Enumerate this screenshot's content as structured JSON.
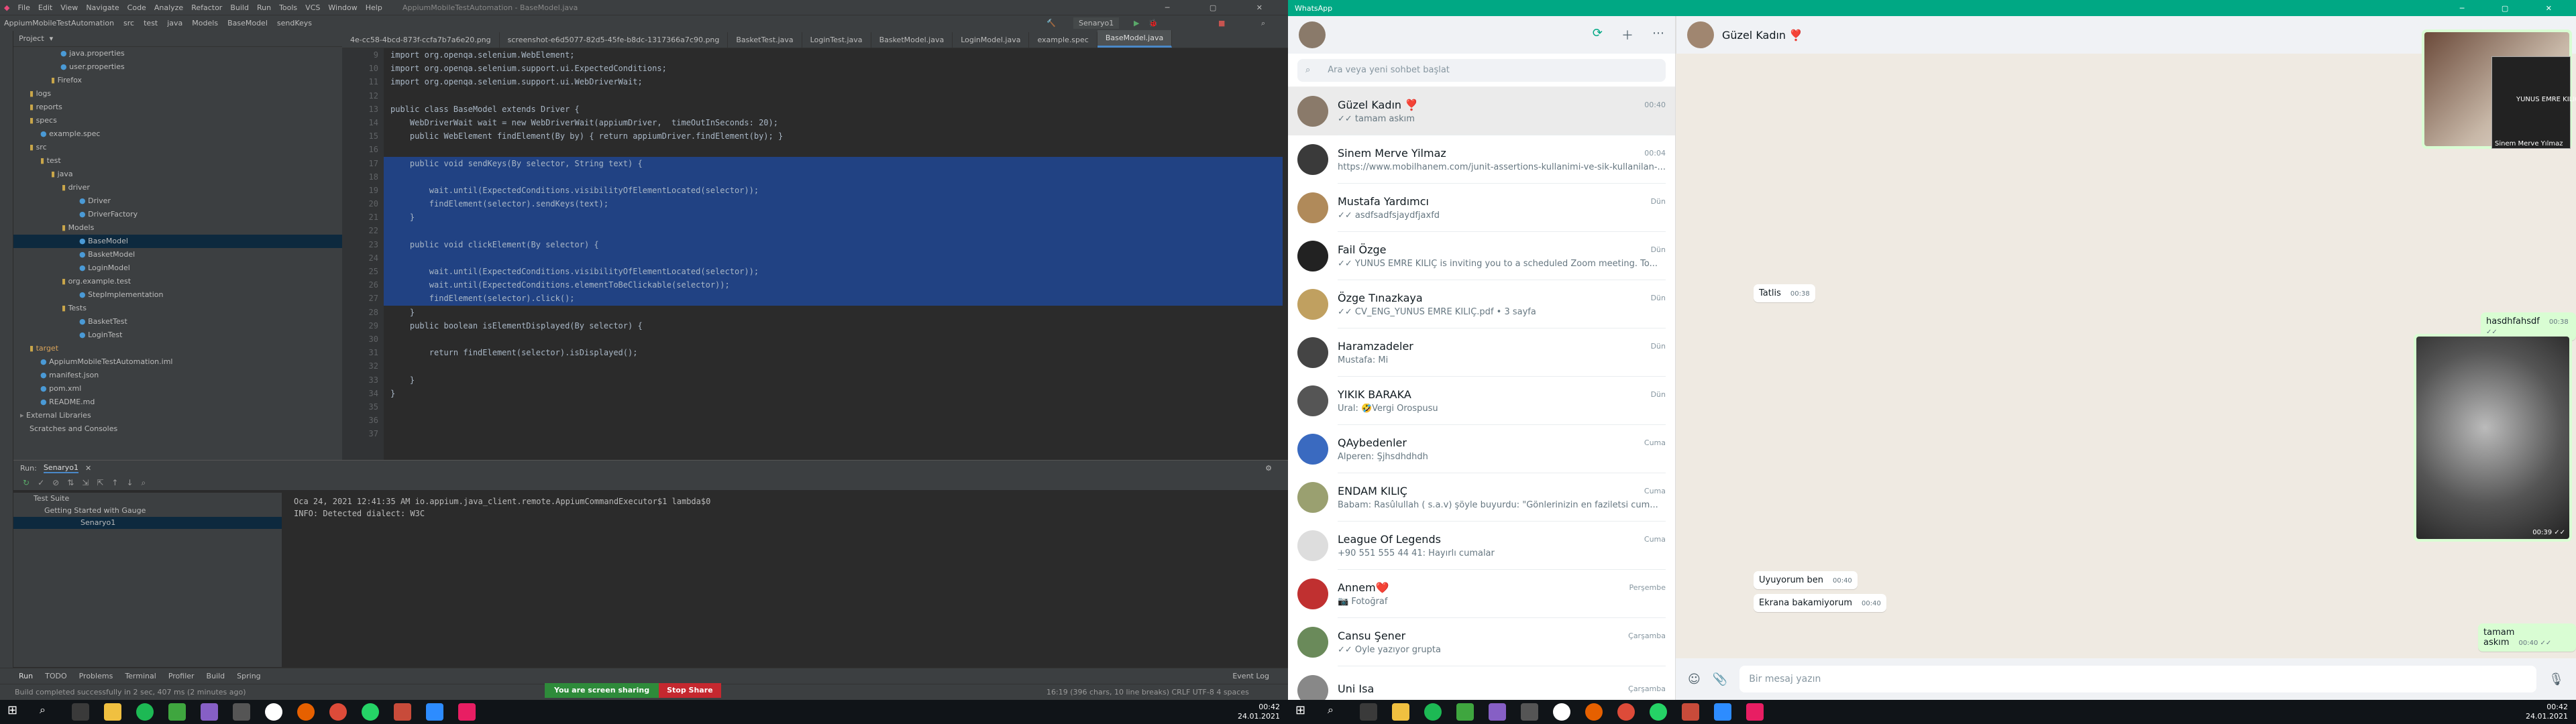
{
  "ide": {
    "title": "AppiumMobileTestAutomation - BaseModel.java",
    "menu": [
      "File",
      "Edit",
      "View",
      "Navigate",
      "Code",
      "Analyze",
      "Refactor",
      "Build",
      "Run",
      "Tools",
      "VCS",
      "Window",
      "Help"
    ],
    "breadcrumbs": [
      "AppiumMobileTestAutomation",
      "src",
      "test",
      "java",
      "Models",
      "BaseModel",
      "sendKeys"
    ],
    "run_config": "Senaryo1",
    "project_label": "Project",
    "tree": [
      "java.properties",
      "user.properties",
      "Firefox",
      "logs",
      "reports",
      "specs",
      "example.spec",
      "src",
      "test",
      "java",
      "driver",
      "Driver",
      "DriverFactory",
      "Models",
      "BaseModel",
      "BasketModel",
      "LoginModel",
      "org.example.test",
      "StepImplementation",
      "Tests",
      "BasketTest",
      "LoginTest",
      "target",
      "AppiumMobileTestAutomation.iml",
      "manifest.json",
      "pom.xml",
      "README.md",
      "External Libraries",
      "Scratches and Consoles"
    ],
    "tabs": [
      "4e-cc58-4bcd-873f-ccfa7b7a6e20.png",
      "screenshot-e6d5077-82d5-45fe-b8dc-1317366a7c90.png",
      "BasketTest.java",
      "LoginTest.java",
      "BasketModel.java",
      "LoginModel.java",
      "example.spec",
      "BaseModel.java"
    ],
    "code": [
      "import org.openqa.selenium.WebElement;",
      "import org.openqa.selenium.support.ui.ExpectedConditions;",
      "import org.openqa.selenium.support.ui.WebDriverWait;",
      "",
      "public class BaseModel extends Driver {",
      "    WebDriverWait wait = new WebDriverWait(appiumDriver,  timeOutInSeconds: 20);",
      "    public WebElement findElement(By by) { return appiumDriver.findElement(by); }",
      "",
      "    public void sendKeys(By selector, String text) {",
      "",
      "        wait.until(ExpectedConditions.visibilityOfElementLocated(selector));",
      "        findElement(selector).sendKeys(text);",
      "    }",
      "",
      "    public void clickElement(By selector) {",
      "",
      "        wait.until(ExpectedConditions.visibilityOfElementLocated(selector));",
      "        wait.until(ExpectedConditions.elementToBeClickable(selector));",
      "        findElement(selector).click();",
      "    }",
      "    public boolean isElementDisplayed(By selector) {",
      "",
      "        return findElement(selector).isDisplayed();",
      "",
      "    }",
      "}",
      "",
      "",
      ""
    ],
    "line_numbers": [
      "9",
      "10",
      "11",
      "12",
      "13",
      "14",
      "15",
      "16",
      "17",
      "18",
      "19",
      "20",
      "21",
      "22",
      "23",
      "24",
      "25",
      "26",
      "27",
      "28",
      "29",
      "30",
      "31",
      "32",
      "33",
      "34",
      "35",
      "36",
      "37"
    ],
    "run_label": "Run:",
    "run_tab": "Senaryo1",
    "run_tree": [
      "Test Suite",
      "Getting Started with Gauge",
      "Senaryo1"
    ],
    "console": [
      "Oca 24, 2021 12:41:35 AM io.appium.java_client.remote.AppiumCommandExecutor$1 lambda$0",
      "INFO: Detected dialect: W3C"
    ],
    "bottom_tools": [
      "Run",
      "TODO",
      "Problems",
      "Terminal",
      "Profiler",
      "Build",
      "Spring"
    ],
    "event_log": "Event Log",
    "status": "Build completed successfully in 2 sec, 407 ms (2 minutes ago)",
    "status_right": "16:19 (396 chars, 10 line breaks)   CRLF   UTF-8   4 spaces",
    "share_text": "You are screen sharing",
    "stop_share": "Stop Share"
  },
  "whatsapp": {
    "window_title": "WhatsApp",
    "search_placeholder": "Ara veya yeni sohbet başlat",
    "chats": [
      {
        "name": "Güzel Kadın ❣️",
        "time": "00:40",
        "preview": "✓✓ tamam askım"
      },
      {
        "name": "Sinem Merve Yilmaz",
        "time": "00:04",
        "preview": "https://www.mobilhanem.com/junit-assertions-kullanimi-ve-sik-kullanilan-..."
      },
      {
        "name": "Mustafa Yardımcı",
        "time": "Dün",
        "preview": "✓✓ asdfsadfsjaydfjaxfd"
      },
      {
        "name": "Fail Özge",
        "time": "Dün",
        "preview": "✓✓ YUNUS EMRE KILIÇ is inviting you to a scheduled Zoom meeting. To..."
      },
      {
        "name": "Özge Tınazkaya",
        "time": "Dün",
        "preview": "✓✓ CV_ENG_YUNUS EMRE KILIÇ.pdf • 3 sayfa"
      },
      {
        "name": "Haramzadeler",
        "time": "Dün",
        "preview": "Mustafa: Mi"
      },
      {
        "name": "YIKIK BARAKA",
        "time": "Dün",
        "preview": "Ural: 🤣Vergi Orospusu"
      },
      {
        "name": "QAybedenler",
        "time": "Cuma",
        "preview": "Alperen: Şjhsdhdhdh"
      },
      {
        "name": "ENDAM KILIÇ",
        "time": "Cuma",
        "preview": "Babam: Rasûlullah ( s.a.v) şöyle buyurdu: \"Gönlerinizin en faziletsi cum..."
      },
      {
        "name": "League Of Legends",
        "time": "Cuma",
        "preview": "+90 551 555 44 41: Hayırlı cumalar"
      },
      {
        "name": "Annem❤️",
        "time": "Perşembe",
        "preview": "📷 Fotoğraf"
      },
      {
        "name": "Cansu Şener",
        "time": "Çarşamba",
        "preview": "✓✓ Oyle yazıyor grupta"
      },
      {
        "name": "Uni Isa",
        "time": "Çarşamba",
        "preview": ""
      }
    ],
    "contact": "Güzel Kadın ❣️",
    "messages": {
      "m1": {
        "text": "Tatlis",
        "time": "00:38"
      },
      "m2": {
        "text": "hasdhfahsdf",
        "time": "00:38 ✓✓"
      },
      "m3": {
        "text": "",
        "time": "00:39 ✓✓"
      },
      "m4": {
        "text": "Uyuyorum ben",
        "time": "00:40"
      },
      "m5": {
        "text": "Ekrana bakamiyorum",
        "time": "00:40"
      },
      "m6": {
        "text": "tamam askım",
        "time": "00:40 ✓✓"
      }
    },
    "video_labels": [
      "YUNUS EMRE KILIÇ",
      "Sinem Merve Yılmaz"
    ],
    "compose_placeholder": "Bir mesaj yazın"
  },
  "taskbar": {
    "time": "00:42",
    "date": "24.01.2021"
  }
}
